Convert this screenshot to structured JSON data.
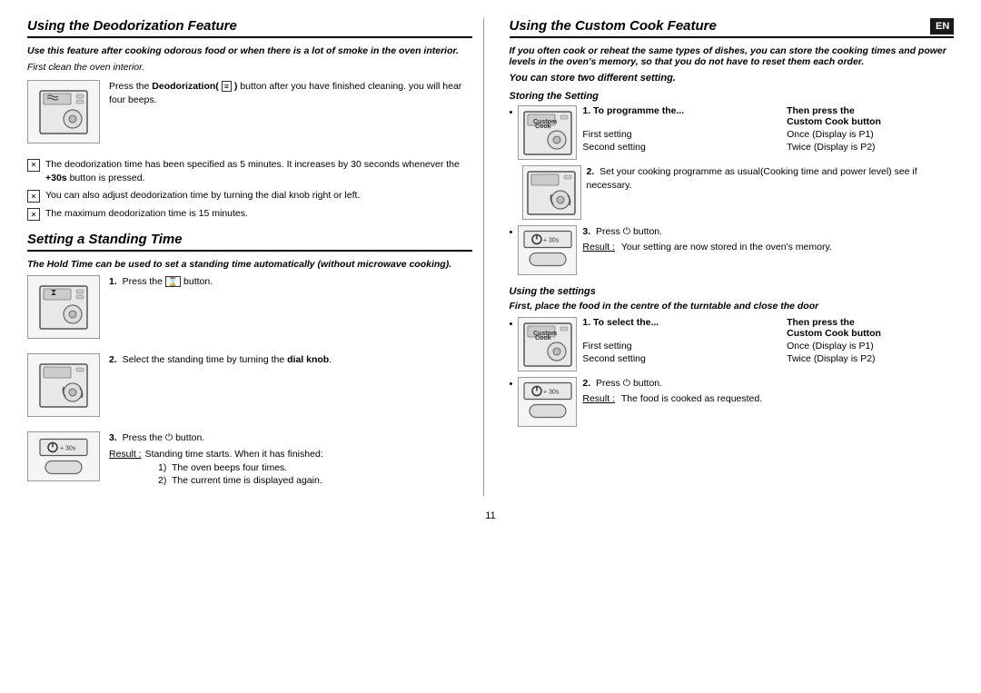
{
  "page": {
    "page_number": "11",
    "en_badge": "EN"
  },
  "left": {
    "deodorization": {
      "title": "Using the Deodorization Feature",
      "intro": "Use this feature after cooking odorous food or when there is a lot of smoke in the oven interior.",
      "first_clean": "First clean the oven interior.",
      "step1_text": "Press the Deodorization(  ) button after you have finished cleaning. you will hear four beeps.",
      "step1_bold": "Deodorization",
      "bullet1": "The deodorization time has been specified as 5 minutes. It increases by 30 seconds whenever the +30s button is pressed.",
      "bullet1_bold": "+30s",
      "bullet2": "You can also adjust deodorization time by turning the dial knob right or left.",
      "bullet3": "The maximum deodorization time is 15 minutes."
    },
    "standing_time": {
      "title": "Setting a Standing Time",
      "intro": "The Hold Time can be used to set a standing time automatically (without microwave cooking).",
      "step1_label": "1.",
      "step1_text": "Press the   button.",
      "step2_label": "2.",
      "step2_text": "Select the standing time by turning the dial knob.",
      "step2_bold": "dial knob",
      "step3_label": "3.",
      "step3_text": "Press the   button.",
      "result_label": "Result :",
      "result_text": "Standing time starts. When it has finished:",
      "result_sub1": "1)  The oven beeps four times.",
      "result_sub2": "2)  The current time is displayed again."
    }
  },
  "right": {
    "custom_cook": {
      "title": "Using the Custom Cook Feature",
      "intro": "If you often cook or reheat the same types of dishes, you can store the cooking times and power levels in the oven's memory, so that you do not have to reset them each order.",
      "can_store": "You can store two different setting.",
      "storing_title": "Storing the Setting",
      "table_header_desc": "To programme the...",
      "table_header_press": "Then press the",
      "table_header_press2": "Custom Cook button",
      "row1_desc": "First setting",
      "row1_press": "Once (Display is P1)",
      "row2_desc": "Second setting",
      "row2_press": "Twice (Display is P2)",
      "step2_label": "2.",
      "step2_text": "Set your cooking programme as usual(Cooking time and power level) see if necessary.",
      "step3_label": "3.",
      "step3_text": "Press   button.",
      "step3_button": "⏻",
      "result3_label": "Result :",
      "result3_text": "Your setting are now stored in the oven's memory.",
      "using_settings_title": "Using the settings",
      "using_intro": "First, place the food in the centre of the turntable and close the door",
      "table2_header_desc": "To select the...",
      "table2_header_press": "Then press the",
      "table2_header_press2": "Custom Cook button",
      "table2_row1_desc": "First setting",
      "table2_row1_press": "Once (Display is P1)",
      "table2_row2_desc": "Second setting",
      "table2_row2_press": "Twice (Display is P2)",
      "step2b_label": "2.",
      "step2b_text": "Press   button.",
      "result2b_label": "Result :",
      "result2b_text": "The food is cooked as requested."
    }
  }
}
